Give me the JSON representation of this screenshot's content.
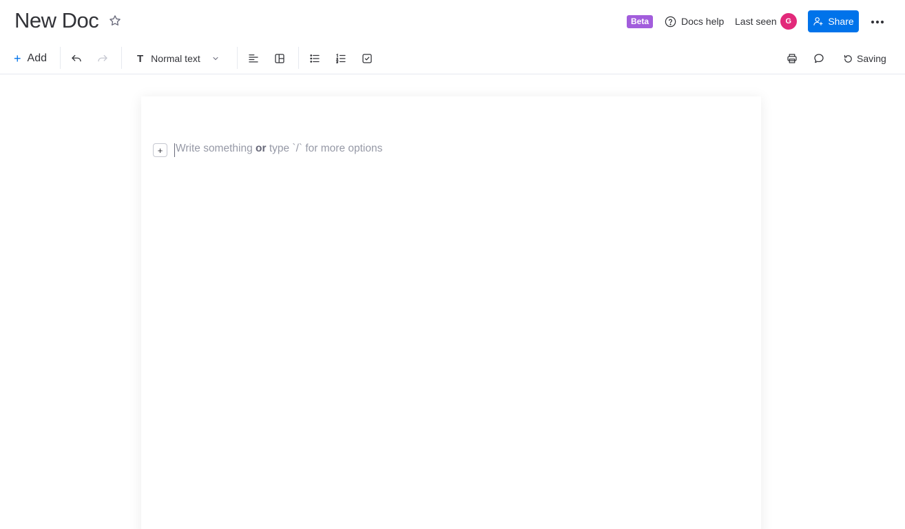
{
  "header": {
    "title": "New Doc",
    "beta_badge": "Beta",
    "help_label": "Docs help",
    "last_seen_label": "Last seen",
    "avatar_initial": "G",
    "share_label": "Share"
  },
  "toolbar": {
    "add_label": "Add",
    "text_style_icon": "T",
    "text_style_label": "Normal text",
    "saving_label": "Saving"
  },
  "editor": {
    "block_add": "+",
    "placeholder_part1": "Write something ",
    "placeholder_bold": "or",
    "placeholder_part2": " type `/` for more options"
  },
  "icons": [
    "star-icon",
    "help-icon",
    "user-plus-icon",
    "more-icon",
    "undo-icon",
    "redo-icon",
    "chevron-down-icon",
    "align-left-icon",
    "layout-icon",
    "bullet-list-icon",
    "numbered-list-icon",
    "checklist-icon",
    "print-icon",
    "comment-icon",
    "refresh-icon"
  ],
  "colors": {
    "beta": "#a25ddc",
    "share": "#0073ea",
    "avatar": "#e2297a",
    "add_accent": "#0073ea"
  }
}
